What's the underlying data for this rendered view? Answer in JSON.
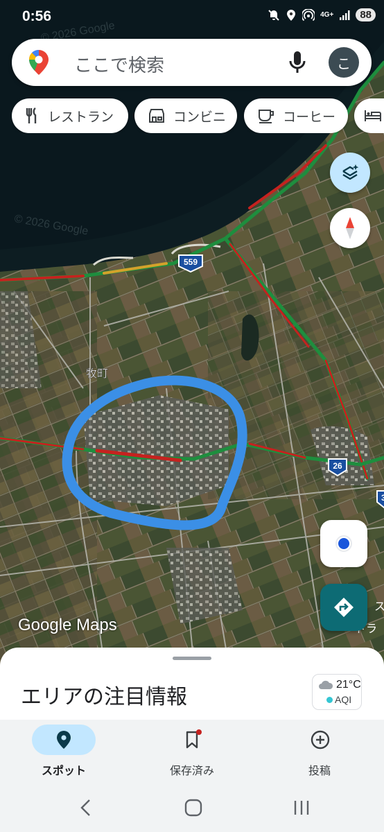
{
  "status_bar": {
    "time": "0:56",
    "network_label": "4G+",
    "battery": "88"
  },
  "search": {
    "placeholder": "ここで検索",
    "avatar_initial": "こ"
  },
  "chips": [
    {
      "label": "レストラン",
      "icon": "restaurant-icon"
    },
    {
      "label": "コンビニ",
      "icon": "convenience-store-icon"
    },
    {
      "label": "コーヒー",
      "icon": "coffee-icon"
    },
    {
      "label": "",
      "icon": "hotel-icon"
    }
  ],
  "map": {
    "place_label": "牧町",
    "route_badges": [
      "559",
      "26",
      "3"
    ],
    "watermarks": [
      "© 2026 Google",
      "© 2026 Google"
    ],
    "edge_text": [
      "ス",
      "ドラ"
    ],
    "attribution": "Google Maps",
    "highlight_color": "#3b8fe6"
  },
  "map_controls": {
    "layers": "layers-icon",
    "compass": "compass-icon",
    "location": "my-location-icon",
    "directions": "directions-icon"
  },
  "sheet": {
    "title": "エリアの注目情報",
    "weather": {
      "temp": "21°C",
      "aqi_label": "AQI"
    }
  },
  "bottom_nav": [
    {
      "label": "スポット",
      "icon": "pin-icon",
      "active": true
    },
    {
      "label": "保存済み",
      "icon": "bookmark-icon",
      "active": false,
      "badge": true
    },
    {
      "label": "投稿",
      "icon": "plus-circle-icon",
      "active": false
    }
  ],
  "colors": {
    "accent": "#0d6b74",
    "active_pill": "#c2e7ff",
    "traffic_red": "#c5221f",
    "traffic_green": "#1e8e3e"
  }
}
